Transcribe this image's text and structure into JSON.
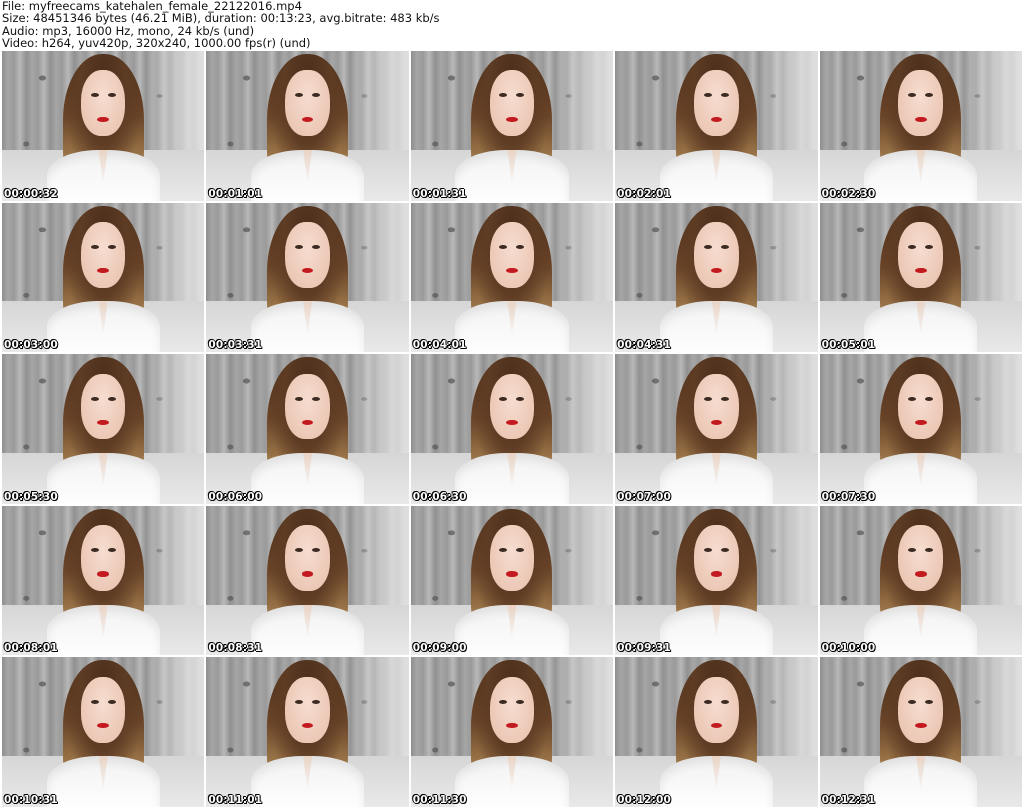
{
  "header": {
    "file_line": "File: myfreecams_katehalen_female_22122016.mp4",
    "size_line": "Size: 48451346 bytes (46.21 MiB), duration: 00:13:23, avg.bitrate: 483 kb/s",
    "audio_line": "Audio: mp3, 16000 Hz, mono, 24 kb/s (und)",
    "video_line": "Video: h264, yuv420p, 320x240, 1000.00 fps(r) (und)"
  },
  "thumbnails": [
    {
      "timestamp": "00:00:32"
    },
    {
      "timestamp": "00:01:01"
    },
    {
      "timestamp": "00:01:31"
    },
    {
      "timestamp": "00:02:01"
    },
    {
      "timestamp": "00:02:30"
    },
    {
      "timestamp": "00:03:00"
    },
    {
      "timestamp": "00:03:31"
    },
    {
      "timestamp": "00:04:01"
    },
    {
      "timestamp": "00:04:31"
    },
    {
      "timestamp": "00:05:01"
    },
    {
      "timestamp": "00:05:30"
    },
    {
      "timestamp": "00:06:00"
    },
    {
      "timestamp": "00:06:30"
    },
    {
      "timestamp": "00:07:00"
    },
    {
      "timestamp": "00:07:30"
    },
    {
      "timestamp": "00:08:01"
    },
    {
      "timestamp": "00:08:31"
    },
    {
      "timestamp": "00:09:00"
    },
    {
      "timestamp": "00:09:31"
    },
    {
      "timestamp": "00:10:00"
    },
    {
      "timestamp": "00:10:31"
    },
    {
      "timestamp": "00:11:01"
    },
    {
      "timestamp": "00:11:30"
    },
    {
      "timestamp": "00:12:00"
    },
    {
      "timestamp": "00:12:31"
    }
  ],
  "colors": {
    "background": "#ffffff",
    "header_text": "#111111",
    "timestamp_text": "#ffffff",
    "timestamp_outline": "#000000"
  }
}
